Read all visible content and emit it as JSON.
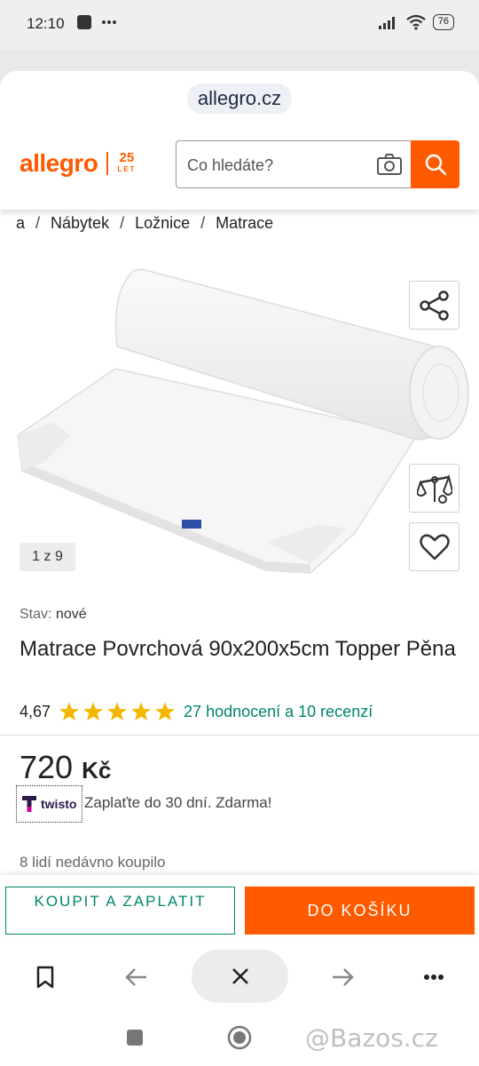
{
  "status_bar": {
    "time": "12:10",
    "battery": "76"
  },
  "browser": {
    "url": "allegro.cz"
  },
  "header": {
    "logo": "allegro",
    "logo_badge_top": "25",
    "logo_badge_bottom": "LET",
    "search_placeholder": "Co hledáte?"
  },
  "breadcrumb": [
    "a",
    "Nábytek",
    "Ložnice",
    "Matrace"
  ],
  "gallery": {
    "counter": "1 z 9"
  },
  "product": {
    "condition_label": "Stav:",
    "condition_value": "nové",
    "title": "Matrace Povrchová 90x200x5cm Topper Pěna",
    "rating": "4,67",
    "stars": 5,
    "reviews_link": "27 hodnocení a 10 recenzí",
    "price": "720",
    "currency": "Kč",
    "twisto_logo": "twisto",
    "twisto_note": "Zaplaťte do 30 dní. Zdarma!",
    "recent_buyers": "8 lidí nedávno koupilo"
  },
  "actions": {
    "buy_label": "KOUPIT A ZAPLATIT",
    "cart_label": "DO KOŠÍKU"
  },
  "watermark": "@Bazos.cz",
  "colors": {
    "brand": "#ff5a00",
    "accent_green": "#00866b",
    "star": "#f5b800"
  }
}
